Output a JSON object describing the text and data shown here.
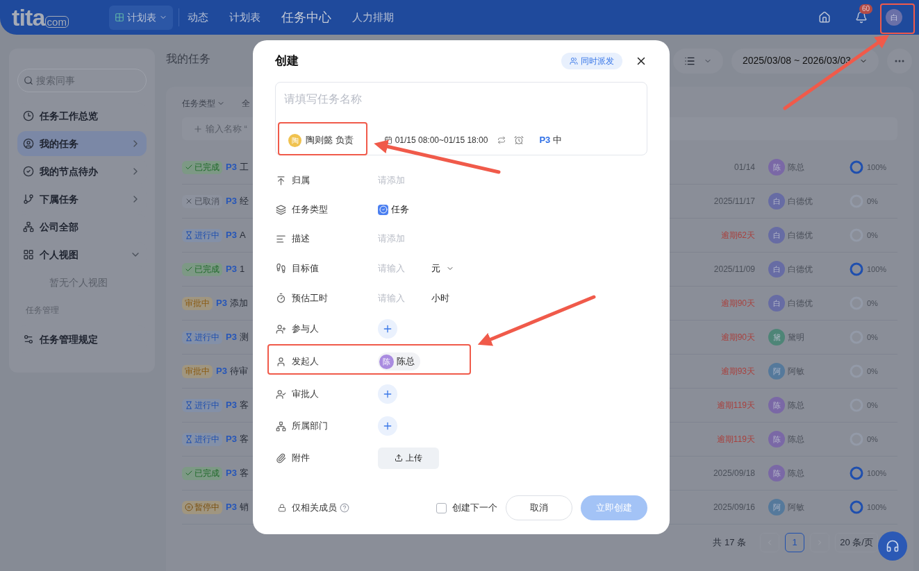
{
  "header": {
    "logo": "tita",
    "logo_suffix": "com",
    "plan_switch": {
      "label": "计划表",
      "selected": true
    },
    "nav": [
      {
        "label": "动态",
        "selected": false
      },
      {
        "label": "计划表",
        "selected": false
      },
      {
        "label": "任务中心",
        "selected": true
      },
      {
        "label": "人力排期",
        "selected": false
      }
    ],
    "notification_count": "60",
    "user_avatar": "白"
  },
  "sidebar": {
    "search_placeholder": "搜索同事",
    "items": [
      {
        "label": "任务工作总览",
        "selected": false
      },
      {
        "label": "我的任务",
        "selected": true,
        "expanded": false
      },
      {
        "label": "我的节点待办",
        "selected": false,
        "expanded": false
      },
      {
        "label": "下属任务",
        "selected": false,
        "expanded": false
      },
      {
        "label": "公司全部",
        "selected": false
      },
      {
        "label": "个人视图",
        "selected": false,
        "expanded": true,
        "children": [
          {
            "label": "暂无个人视图"
          }
        ]
      }
    ],
    "section": "任务管理",
    "section_items": [
      {
        "label": "任务管理规定",
        "selected": false
      }
    ]
  },
  "page": {
    "title": "我的任务",
    "view_switch": {
      "expanded": false
    },
    "date_range": "2025/03/08 ~ 2026/03/03"
  },
  "table": {
    "filters": [
      "任务类型",
      "全"
    ],
    "add_placeholder": "输入名称 “",
    "rows": [
      {
        "status": "已完成",
        "kind": "done",
        "priority": "P3",
        "title": "工",
        "due": "01/14",
        "overdue": false,
        "owner": "陈总",
        "avatar": "陈",
        "color": "#7a68a6",
        "complete": true,
        "progress": "100%"
      },
      {
        "status": "已取消",
        "kind": "cancelled",
        "priority": "P3",
        "title": "经",
        "due": "2025/11/17",
        "overdue": false,
        "owner": "白德优",
        "avatar": "白",
        "color": "#676ca4",
        "complete": false,
        "progress": "0%"
      },
      {
        "status": "进行中",
        "kind": "in_progress",
        "priority": "P3",
        "title": "A",
        "due": "逾期62天",
        "overdue": true,
        "owner": "白德优",
        "avatar": "白",
        "color": "#676ca4",
        "complete": false,
        "progress": "0%"
      },
      {
        "status": "已完成",
        "kind": "done",
        "priority": "P3",
        "title": "1",
        "due": "2025/11/09",
        "overdue": false,
        "owner": "白德优",
        "avatar": "白",
        "color": "#676ca4",
        "complete": true,
        "progress": "100%"
      },
      {
        "status": "审批中",
        "kind": "approving",
        "priority": "P3",
        "title": "添加",
        "due": "逾期90天",
        "overdue": true,
        "owner": "白德优",
        "avatar": "白",
        "color": "#676ca4",
        "complete": false,
        "progress": "0%"
      },
      {
        "status": "进行中",
        "kind": "in_progress",
        "priority": "P3",
        "title": "测",
        "due": "逾期90天",
        "overdue": true,
        "owner": "黛明",
        "avatar": "黛",
        "color": "#4e8577",
        "complete": false,
        "progress": "0%"
      },
      {
        "status": "审批中",
        "kind": "approving",
        "priority": "P3",
        "title": "待审",
        "due": "逾期93天",
        "overdue": true,
        "owner": "阿敏",
        "avatar": "阿",
        "color": "#55799b",
        "complete": false,
        "progress": "0%"
      },
      {
        "status": "进行中",
        "kind": "in_progress",
        "priority": "P3",
        "title": "客",
        "due": "逾期119天",
        "overdue": true,
        "owner": "陈总",
        "avatar": "陈",
        "color": "#7a68a6",
        "complete": false,
        "progress": "0%"
      },
      {
        "status": "进行中",
        "kind": "in_progress",
        "priority": "P3",
        "title": "客",
        "due": "逾期119天",
        "overdue": true,
        "owner": "陈总",
        "avatar": "陈",
        "color": "#7a68a6",
        "complete": false,
        "progress": "0%"
      },
      {
        "status": "已完成",
        "kind": "done",
        "priority": "P3",
        "title": "客",
        "due": "2025/09/18",
        "overdue": false,
        "owner": "陈总",
        "avatar": "陈",
        "color": "#7a68a6",
        "complete": true,
        "progress": "100%"
      },
      {
        "status": "暂停中",
        "kind": "paused",
        "priority": "P3",
        "title": "销",
        "due": "2025/09/16",
        "overdue": false,
        "owner": "阿敏",
        "avatar": "阿",
        "color": "#55799b",
        "complete": true,
        "progress": "100%"
      }
    ],
    "pagination": {
      "total": "共 17 条",
      "pages": [
        {
          "label": "1",
          "selected": true
        }
      ],
      "page_size": "20 条/页"
    }
  },
  "dialog": {
    "title": "创建",
    "dispatch": "同时派发",
    "name_placeholder": "请填写任务名称",
    "owner": {
      "avatar": "陶",
      "label": "陶则懿 负责"
    },
    "time": "01/15 08:00~01/15 18:00",
    "priority": "P3",
    "priority_level": "中",
    "fields": [
      {
        "label": "归属",
        "kind": "text",
        "placeholder": "请添加"
      },
      {
        "label": "任务类型",
        "kind": "type",
        "value": "任务"
      },
      {
        "label": "描述",
        "kind": "text",
        "placeholder": "请添加"
      },
      {
        "label": "目标值",
        "kind": "input",
        "placeholder": "请输入",
        "unit": "元",
        "unit_dropdown": true
      },
      {
        "label": "预估工时",
        "kind": "input",
        "placeholder": "请输入",
        "unit": "小时",
        "unit_dropdown": false
      },
      {
        "label": "参与人",
        "kind": "add"
      },
      {
        "label": "发起人",
        "kind": "person",
        "avatar": "陈",
        "value": "陈总"
      },
      {
        "label": "审批人",
        "kind": "add"
      },
      {
        "label": "所属部门",
        "kind": "add"
      },
      {
        "label": "附件",
        "kind": "upload",
        "value": "上传"
      }
    ],
    "private_label": "仅相关成员",
    "create_next": {
      "label": "创建下一个",
      "checked": false
    },
    "cancel": "取消",
    "submit": "立即创建",
    "submit_disabled": true
  }
}
